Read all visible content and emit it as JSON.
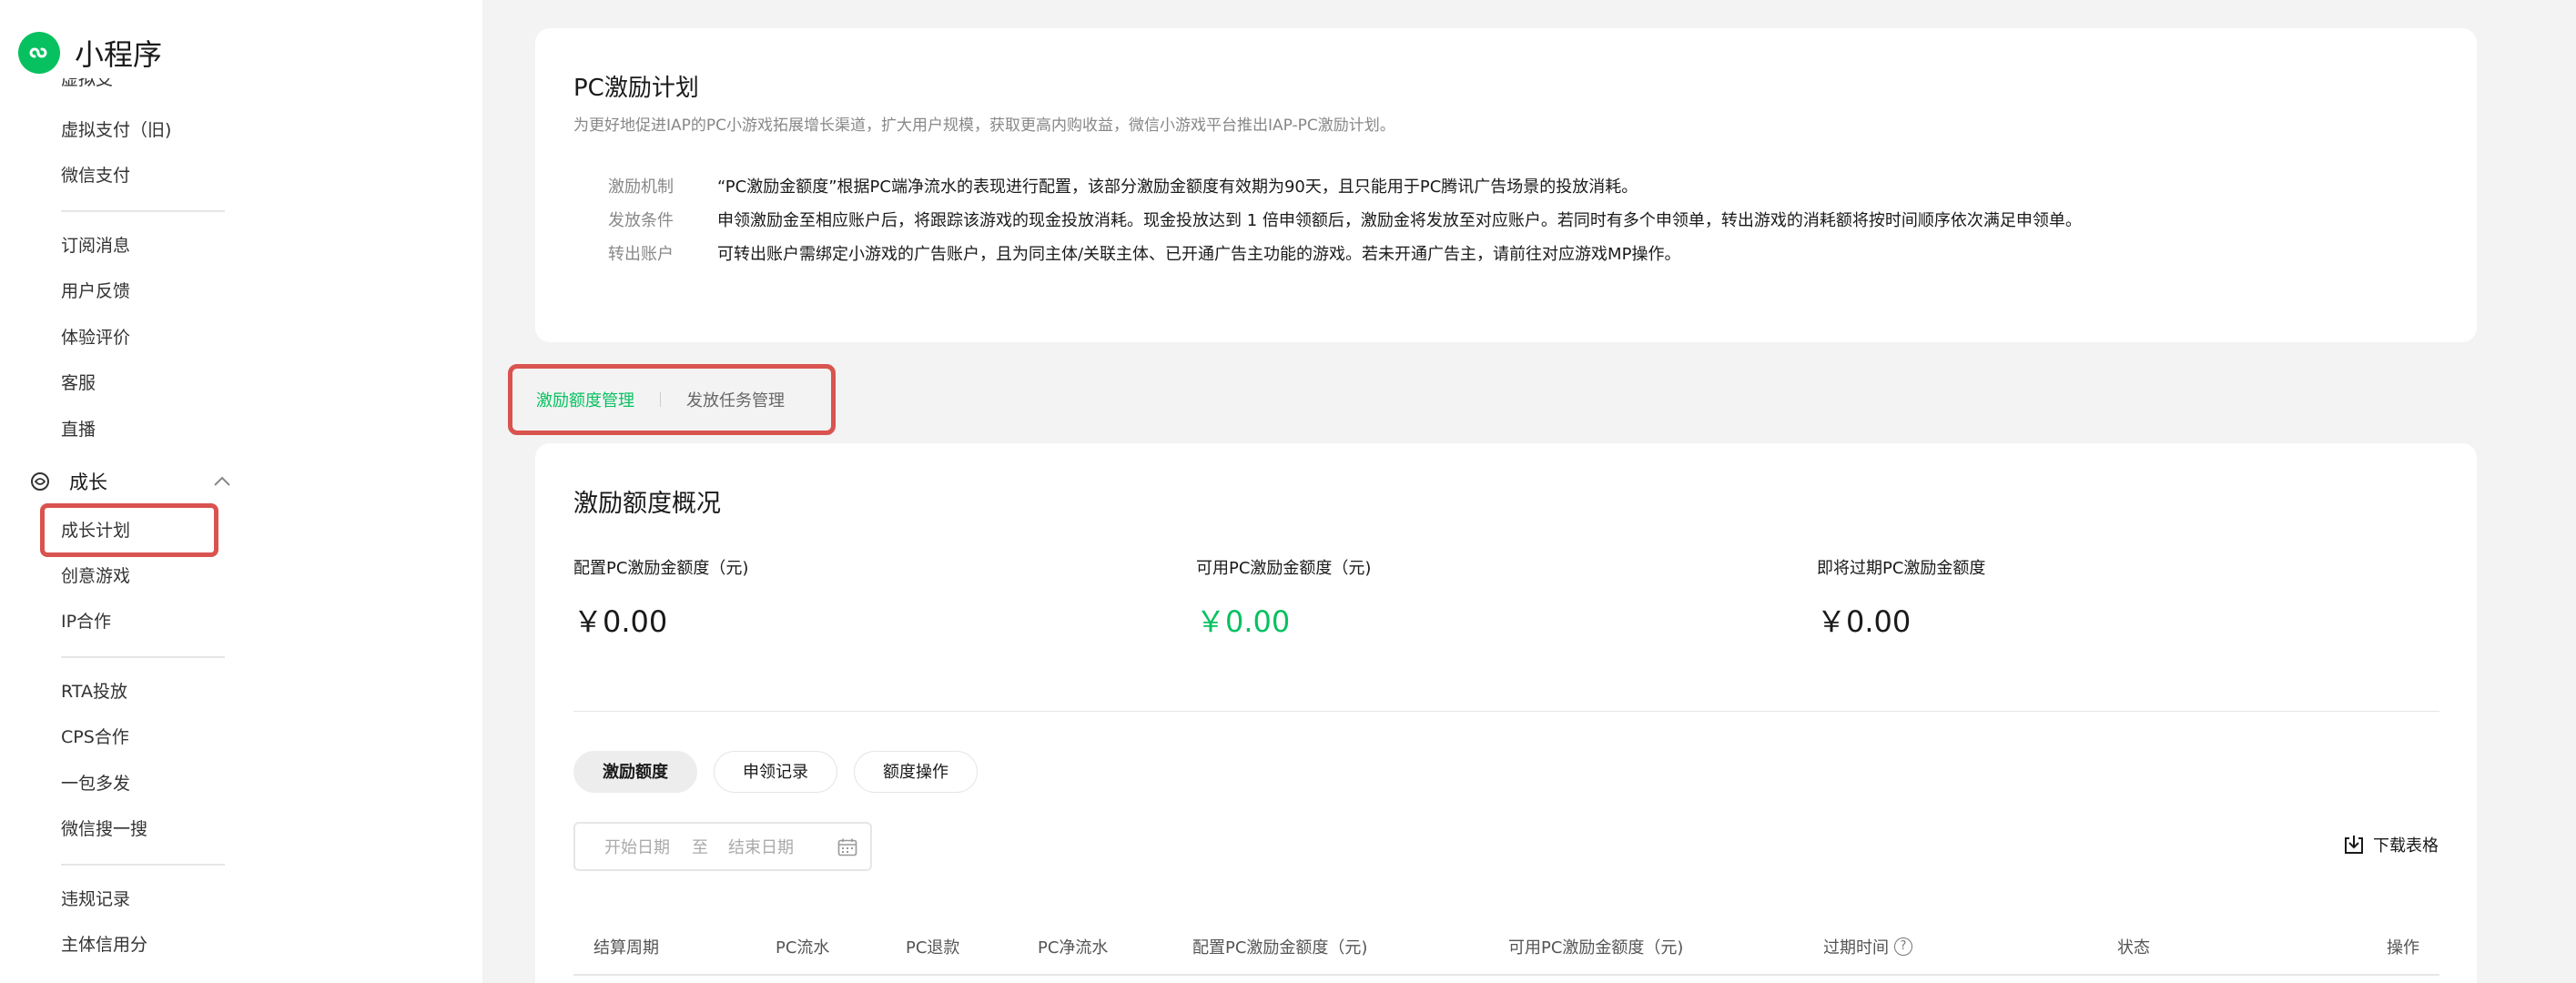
{
  "brand": {
    "name": "小程序"
  },
  "sidebar": {
    "cut_item": "虚拟支付",
    "items": [
      {
        "label": "虚拟支付（旧)"
      },
      {
        "label": "微信支付"
      },
      {
        "label": "订阅消息"
      },
      {
        "label": "用户反馈"
      },
      {
        "label": "体验评价"
      },
      {
        "label": "客服"
      },
      {
        "label": "直播"
      }
    ],
    "group": {
      "label": "成长",
      "icon": "growth-icon",
      "expanded": true
    },
    "group_items": [
      {
        "label": "成长计划",
        "active": true
      },
      {
        "label": "创意游戏"
      },
      {
        "label": "IP合作"
      }
    ],
    "items2": [
      {
        "label": "RTA投放"
      },
      {
        "label": "CPS合作"
      },
      {
        "label": "一包多发"
      },
      {
        "label": "微信搜一搜"
      }
    ],
    "items3": [
      {
        "label": "违规记录"
      },
      {
        "label": "主体信用分"
      }
    ]
  },
  "intro": {
    "title": "PC激励计划",
    "desc": "为更好地促进IAP的PC小游戏拓展增长渠道，扩大用户规模，获取更高内购收益，微信小游戏平台推出IAP-PC激励计划。",
    "rules": [
      {
        "key": "激励机制",
        "value": "“PC激励金额度”根据PC端净流水的表现进行配置，该部分激励金额度有效期为90天，且只能用于PC腾讯广告场景的投放消耗。"
      },
      {
        "key": "发放条件",
        "value": "申领激励金至相应账户后，将跟踪该游戏的现金投放消耗。现金投放达到 1 倍申领额后，激励金将发放至对应账户。若同时有多个申领单，转出游戏的消耗额将按时间顺序依次满足申领单。"
      },
      {
        "key": "转出账户",
        "value": "可转出账户需绑定小游戏的广告账户，且为同主体/关联主体、已开通广告主功能的游戏。若未开通广告主，请前往对应游戏MP操作。"
      }
    ]
  },
  "tabs": {
    "active": "激励额度管理",
    "other": "发放任务管理"
  },
  "overview": {
    "title": "激励额度概况",
    "stats": [
      {
        "label": "配置PC激励金额度（元)",
        "value": "￥0.00"
      },
      {
        "label": "可用PC激励金额度（元)",
        "value": "￥0.00"
      },
      {
        "label": "即将过期PC激励金额度",
        "value": "￥0.00"
      }
    ],
    "accent_color": "#07c160"
  },
  "subtabs": [
    "激励额度",
    "申领记录",
    "额度操作"
  ],
  "date_range": {
    "start_placeholder": "开始日期",
    "separator": "至",
    "end_placeholder": "结束日期"
  },
  "download": {
    "label": "下载表格"
  },
  "table": {
    "headers": [
      "结算周期",
      "PC流水",
      "PC退款",
      "PC净流水",
      "配置PC激励金额度（元)",
      "可用PC激励金额度（元)",
      "过期时间",
      "状态",
      "操作"
    ]
  }
}
